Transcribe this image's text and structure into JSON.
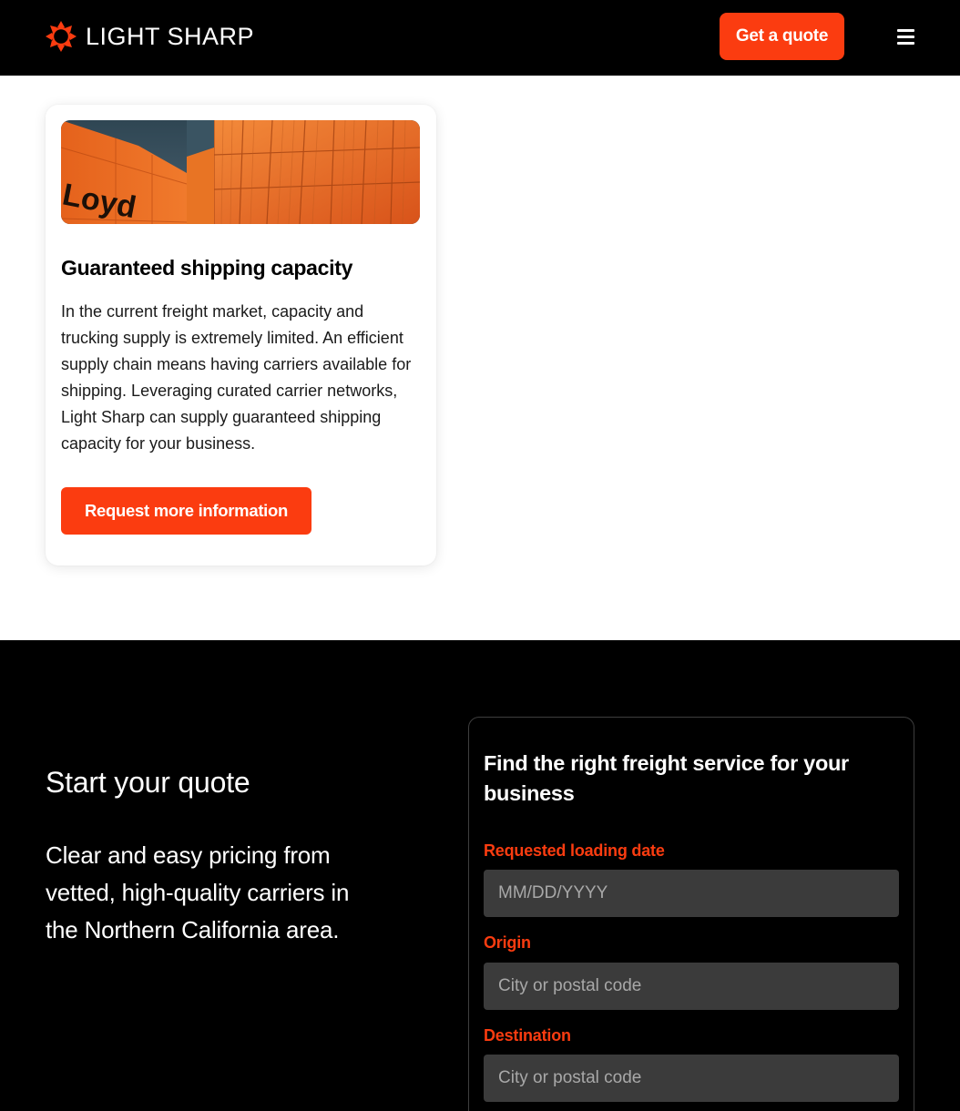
{
  "header": {
    "brand": "LIGHT SHARP",
    "cta_label": "Get a quote",
    "menu_icon": "hamburger-menu-icon",
    "accent_color": "#fb3c10"
  },
  "card": {
    "image_text": "Loyd",
    "title": "Guaranteed shipping capacity",
    "body": "In the current freight market, capacity and trucking supply is extremely limited. An efficient supply chain means having carriers available for shipping. Leveraging curated carrier networks, Light Sharp can supply guaranteed shipping capacity for your business.",
    "button_label": "Request more information"
  },
  "quote": {
    "heading": "Start your quote",
    "description": "Clear and easy pricing from vetted, high-quality carriers in the Northern California area.",
    "form": {
      "title": "Find the right freight service for your business",
      "fields": [
        {
          "label": "Requested loading date",
          "placeholder": "MM/DD/YYYY",
          "value": ""
        },
        {
          "label": "Origin",
          "placeholder": "City or postal code",
          "value": ""
        },
        {
          "label": "Destination",
          "placeholder": "City or postal code",
          "value": ""
        }
      ]
    }
  }
}
